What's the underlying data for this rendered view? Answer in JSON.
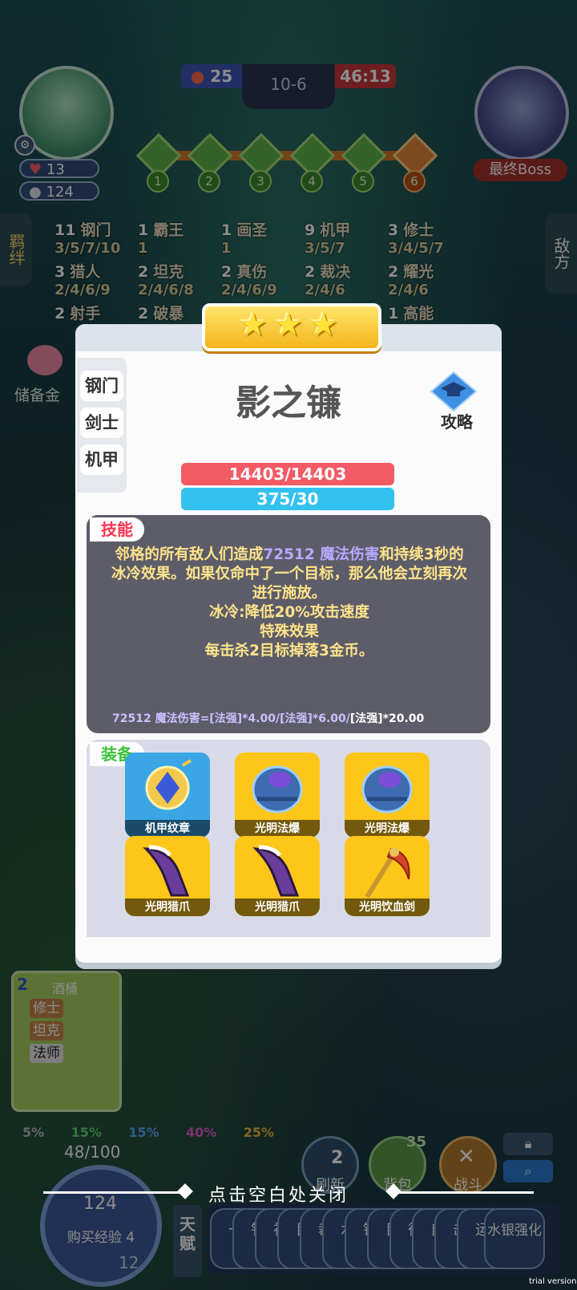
{
  "hud": {
    "player_hp": "13",
    "player_coins": "124",
    "kills": "25",
    "round": "10-6",
    "time": "46:13",
    "stages": [
      "1",
      "2",
      "3",
      "4",
      "5",
      "6"
    ],
    "boss_label": "最终Boss",
    "left_tab": "羁绊",
    "right_tab": "敌方",
    "reserve_label": "储备金"
  },
  "synergies": [
    {
      "count": "11",
      "name": "钢门",
      "levels": "3/5/7/10"
    },
    {
      "count": "1",
      "name": "霸王",
      "levels": "1"
    },
    {
      "count": "1",
      "name": "画圣",
      "levels": "1"
    },
    {
      "count": "9",
      "name": "机甲",
      "levels": "3/5/7"
    },
    {
      "count": "3",
      "name": "修士",
      "levels": "3/4/5/7"
    },
    {
      "count": "3",
      "name": "猎人",
      "levels": "2/4/6/9"
    },
    {
      "count": "2",
      "name": "坦克",
      "levels": "2/4/6/8"
    },
    {
      "count": "2",
      "name": "真伤",
      "levels": "2/4/6/9"
    },
    {
      "count": "2",
      "name": "裁决",
      "levels": "2/4/6"
    },
    {
      "count": "2",
      "name": "耀光",
      "levels": "2/4/6"
    },
    {
      "count": "2",
      "name": "射手",
      "levels": ""
    },
    {
      "count": "2",
      "name": "破暴",
      "levels": ""
    },
    {
      "count": "1",
      "name": "高能",
      "levels": ""
    }
  ],
  "dialog": {
    "stars": 3,
    "traits": [
      "钢门",
      "剑士",
      "机甲"
    ],
    "unit_name": "影之镰",
    "guide_label": "攻略",
    "hp": "14403/14403",
    "mana": "375/30",
    "skill_tag": "技能",
    "skill_line1_a": "邻格的所有敌人们造成",
    "skill_line1_hl": "72512 魔法伤害",
    "skill_line1_b": "和持续3秒的",
    "skill_line2": "冰冷效果。如果仅命中了一个目标，那么他会立刻再次",
    "skill_line3": "进行施放。",
    "skill_line4": "冰冷:降低20%攻击速度",
    "skill_line5": "特殊效果",
    "skill_line6": "每击杀2目标掉落3金币。",
    "formula_a": "72512 魔法伤害=[法强]*4.00/[法强]*6.00/",
    "formula_b": "[法强]*20.00",
    "equip_tag": "装备",
    "equipment": [
      {
        "name": "机甲纹章",
        "color": "#3aa6e6",
        "icon": "emblem-icon"
      },
      {
        "name": "光明法爆",
        "color": "#ffc61a",
        "icon": "crystal-gauntlet-icon"
      },
      {
        "name": "光明法爆",
        "color": "#ffc61a",
        "icon": "crystal-gauntlet-icon"
      },
      {
        "name": "光明猎爪",
        "color": "#ffc61a",
        "icon": "claw-icon"
      },
      {
        "name": "光明猎爪",
        "color": "#ffc61a",
        "icon": "claw-icon"
      },
      {
        "name": "光明饮血剑",
        "color": "#ffc61a",
        "icon": "scythe-icon"
      }
    ]
  },
  "bench": {
    "count": "2",
    "title": "酒桶",
    "tags": [
      "修士",
      "坦克",
      "法师"
    ]
  },
  "odds": [
    "5%",
    "15%",
    "15%",
    "40%",
    "25%"
  ],
  "bottom": {
    "exp": "48/100",
    "gold": "124",
    "buy_exp": "购买经验 4",
    "level": "12",
    "refresh_cost": "2",
    "refresh_label": "刷新",
    "bag_count": "35",
    "bag_label": "背包",
    "fight_label": "战斗",
    "close_hint": "点击空白处关闭",
    "talent_label": "天赋",
    "cards": [
      "一",
      "钅",
      "祈",
      "目",
      "裁",
      "水",
      "钢",
      "目",
      "復",
      "自",
      "击",
      "运",
      "水银强化"
    ]
  },
  "watermark": "trial version"
}
